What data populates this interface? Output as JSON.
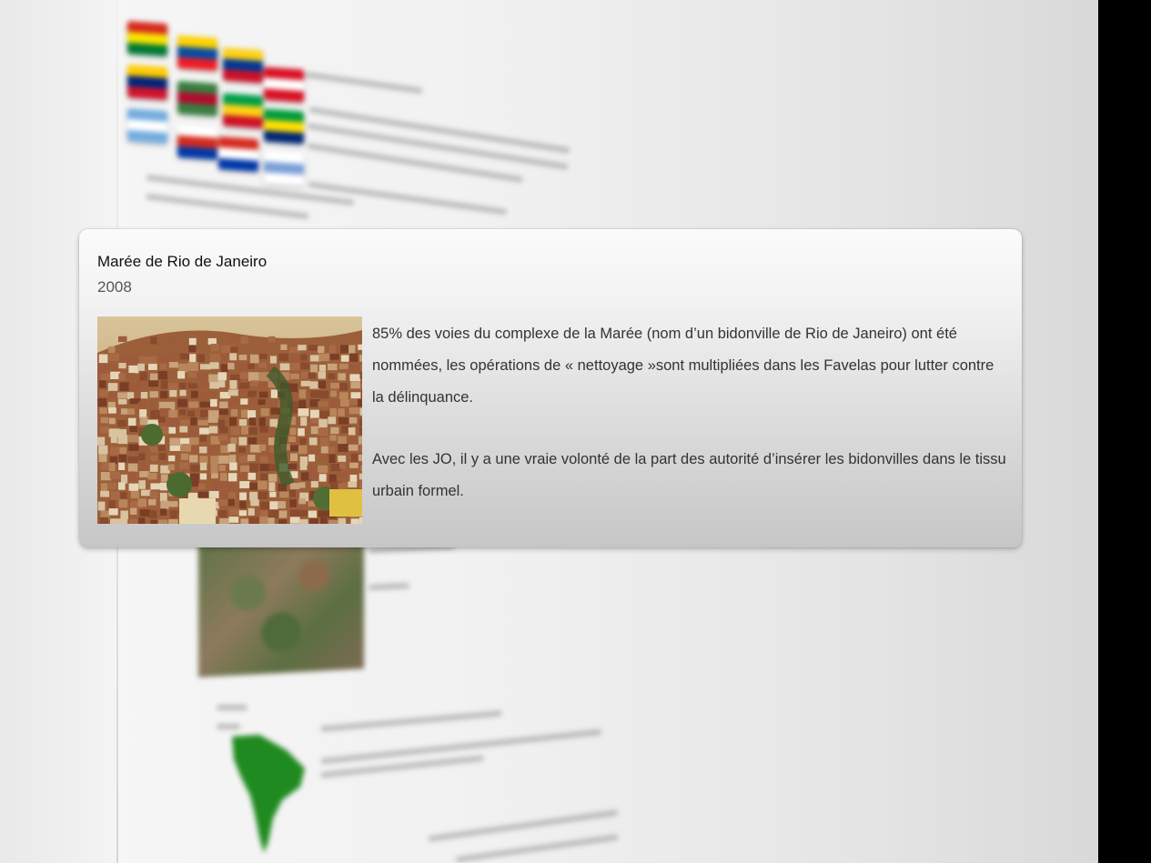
{
  "popup": {
    "title": "Marée de Rio de Janeiro",
    "year": "2008",
    "image_alt": "favela-hillside-photo",
    "paragraphs": [
      "85% des voies du complexe de la Marée (nom d’un bidonville de Rio de Janeiro) ont été nommées, les opérations de « nettoyage »sont multipliées dans les Favelas pour lutter contre la délinquance.",
      "Avec les JO, il y a une vraie volonté de la part des autorité d’insérer les bidonvilles dans le tissu urbain formel."
    ]
  },
  "colors": {
    "card_top": "#fbfbfb",
    "card_bottom": "#c6c6c6",
    "title_text": "#111111",
    "body_text": "#333333",
    "background": "#f1f1f1",
    "right_bar": "#000000"
  },
  "background_flags": [
    {
      "name": "bolivia-flag",
      "colors": [
        "#d52b1e",
        "#f9e300",
        "#007934"
      ]
    },
    {
      "name": "ecuador-flag",
      "colors": [
        "#ffd100",
        "#034ea2",
        "#ed1c24"
      ]
    },
    {
      "name": "colombia-flag",
      "colors": [
        "#fcd116",
        "#003893",
        "#ce1126"
      ]
    },
    {
      "name": "peru-flag",
      "colors": [
        "#d91023",
        "#ffffff",
        "#d91023"
      ]
    },
    {
      "name": "venezuela-flag",
      "colors": [
        "#ffcc00",
        "#00247d",
        "#cf142b"
      ]
    },
    {
      "name": "suriname-flag",
      "colors": [
        "#377e3f",
        "#b40a2d",
        "#377e3f"
      ]
    },
    {
      "name": "guyana-flag",
      "colors": [
        "#009e49",
        "#fcd116",
        "#ce1126"
      ]
    },
    {
      "name": "brazil-flag",
      "colors": [
        "#009c3b",
        "#ffdf00",
        "#002776"
      ]
    },
    {
      "name": "argentina-flag",
      "colors": [
        "#74acdf",
        "#ffffff",
        "#74acdf"
      ]
    },
    {
      "name": "chile-flag",
      "colors": [
        "#ffffff",
        "#d52b1e",
        "#0039a6"
      ]
    },
    {
      "name": "paraguay-flag",
      "colors": [
        "#d52b1e",
        "#ffffff",
        "#0038a8"
      ]
    },
    {
      "name": "uruguay-flag",
      "colors": [
        "#ffffff",
        "#7b9fd6",
        "#ffffff"
      ]
    }
  ]
}
